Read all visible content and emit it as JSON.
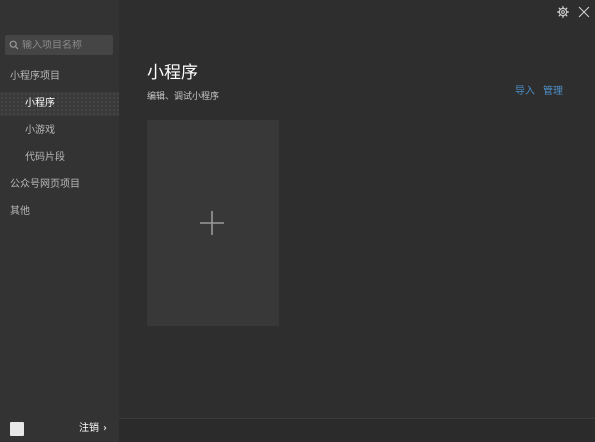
{
  "sidebar": {
    "search_placeholder": "输入项目名称",
    "groups": [
      {
        "label": "小程序项目"
      },
      {
        "label": "小程序"
      },
      {
        "label": "小游戏"
      },
      {
        "label": "代码片段"
      },
      {
        "label": "公众号网页项目"
      },
      {
        "label": "其他"
      }
    ],
    "active_item": "小程序",
    "logout_label": "注销",
    "logout_chevron": "›"
  },
  "main": {
    "title": "小程序",
    "subtitle": "编辑、调试小程序",
    "actions": {
      "import_label": "导入",
      "manage_label": "管理"
    },
    "new_project_icon": "plus-icon"
  },
  "window": {
    "settings_icon": "gear-icon",
    "close_icon": "close-icon"
  },
  "colors": {
    "background": "#2e2e2e",
    "sidebar_background": "#333333",
    "accent_link": "#4e8fc7",
    "card_background": "#383838"
  }
}
